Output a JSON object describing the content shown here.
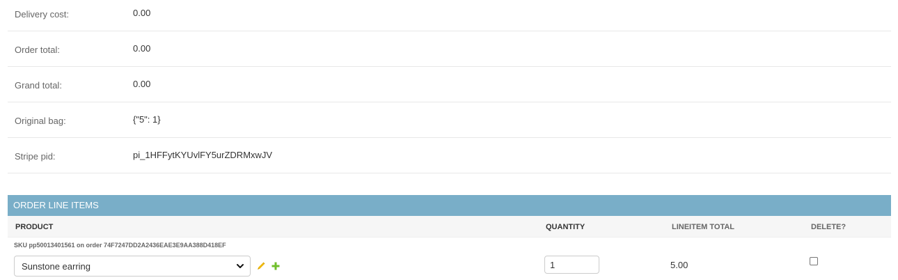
{
  "order_fields": [
    {
      "label": "Delivery cost:",
      "value": "0.00"
    },
    {
      "label": "Order total:",
      "value": "0.00"
    },
    {
      "label": "Grand total:",
      "value": "0.00"
    },
    {
      "label": "Original bag:",
      "value": "{\"5\": 1}"
    },
    {
      "label": "Stripe pid:",
      "value": "pi_1HFFytKYUvlFY5urZDRMxwJV"
    }
  ],
  "inline": {
    "title": "ORDER LINE ITEMS",
    "columns": {
      "product": "PRODUCT",
      "quantity": "QUANTITY",
      "lineitem_total": "LINEITEM TOTAL",
      "delete": "DELETE?"
    },
    "rows": [
      {
        "original": "SKU pp50013401561 on order 74F7247DD2A2436EAE3E9AA388D418EF",
        "product": "Sunstone earring",
        "quantity": "1",
        "lineitem_total": "5.00",
        "delete": false
      }
    ]
  },
  "colors": {
    "module_header": "#79aec8",
    "table_head": "#f6f6f6",
    "edit_icon": "#efb80b",
    "add_icon": "#70bf2b"
  },
  "icons": {
    "edit": "pencil-icon",
    "add": "plus-icon",
    "select_arrow": "chevron-down-icon"
  }
}
